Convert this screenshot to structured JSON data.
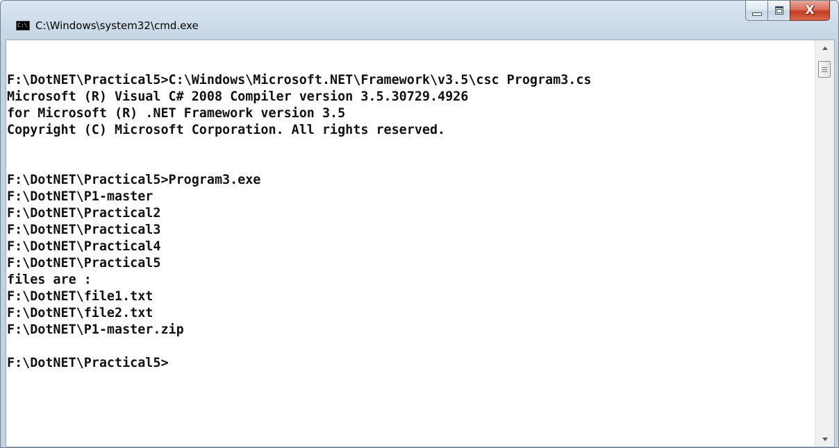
{
  "window": {
    "title": "C:\\Windows\\system32\\cmd.exe",
    "icon_text": "C:\\",
    "icon": "cmd-icon"
  },
  "caption_buttons": {
    "minimize_icon": "minimize-icon",
    "maximize_icon": "maximize-icon",
    "close_icon": "close-icon",
    "close_glyph": "X"
  },
  "console": {
    "lines": [
      "",
      "F:\\DotNET\\Practical5>C:\\Windows\\Microsoft.NET\\Framework\\v3.5\\csc Program3.cs",
      "Microsoft (R) Visual C# 2008 Compiler version 3.5.30729.4926",
      "for Microsoft (R) .NET Framework version 3.5",
      "Copyright (C) Microsoft Corporation. All rights reserved.",
      "",
      "",
      "F:\\DotNET\\Practical5>Program3.exe",
      "F:\\DotNET\\P1-master",
      "F:\\DotNET\\Practical2",
      "F:\\DotNET\\Practical3",
      "F:\\DotNET\\Practical4",
      "F:\\DotNET\\Practical5",
      "files are :",
      "F:\\DotNET\\file1.txt",
      "F:\\DotNET\\file2.txt",
      "F:\\DotNET\\P1-master.zip",
      "",
      "F:\\DotNET\\Practical5>"
    ]
  },
  "scrollbar": {
    "up_icon": "scroll-up-arrow-icon",
    "down_icon": "scroll-down-arrow-icon",
    "position": 0.0
  },
  "colors": {
    "console_text": "#111111",
    "console_background": "#ffffff",
    "close_button": "#c23a22"
  }
}
